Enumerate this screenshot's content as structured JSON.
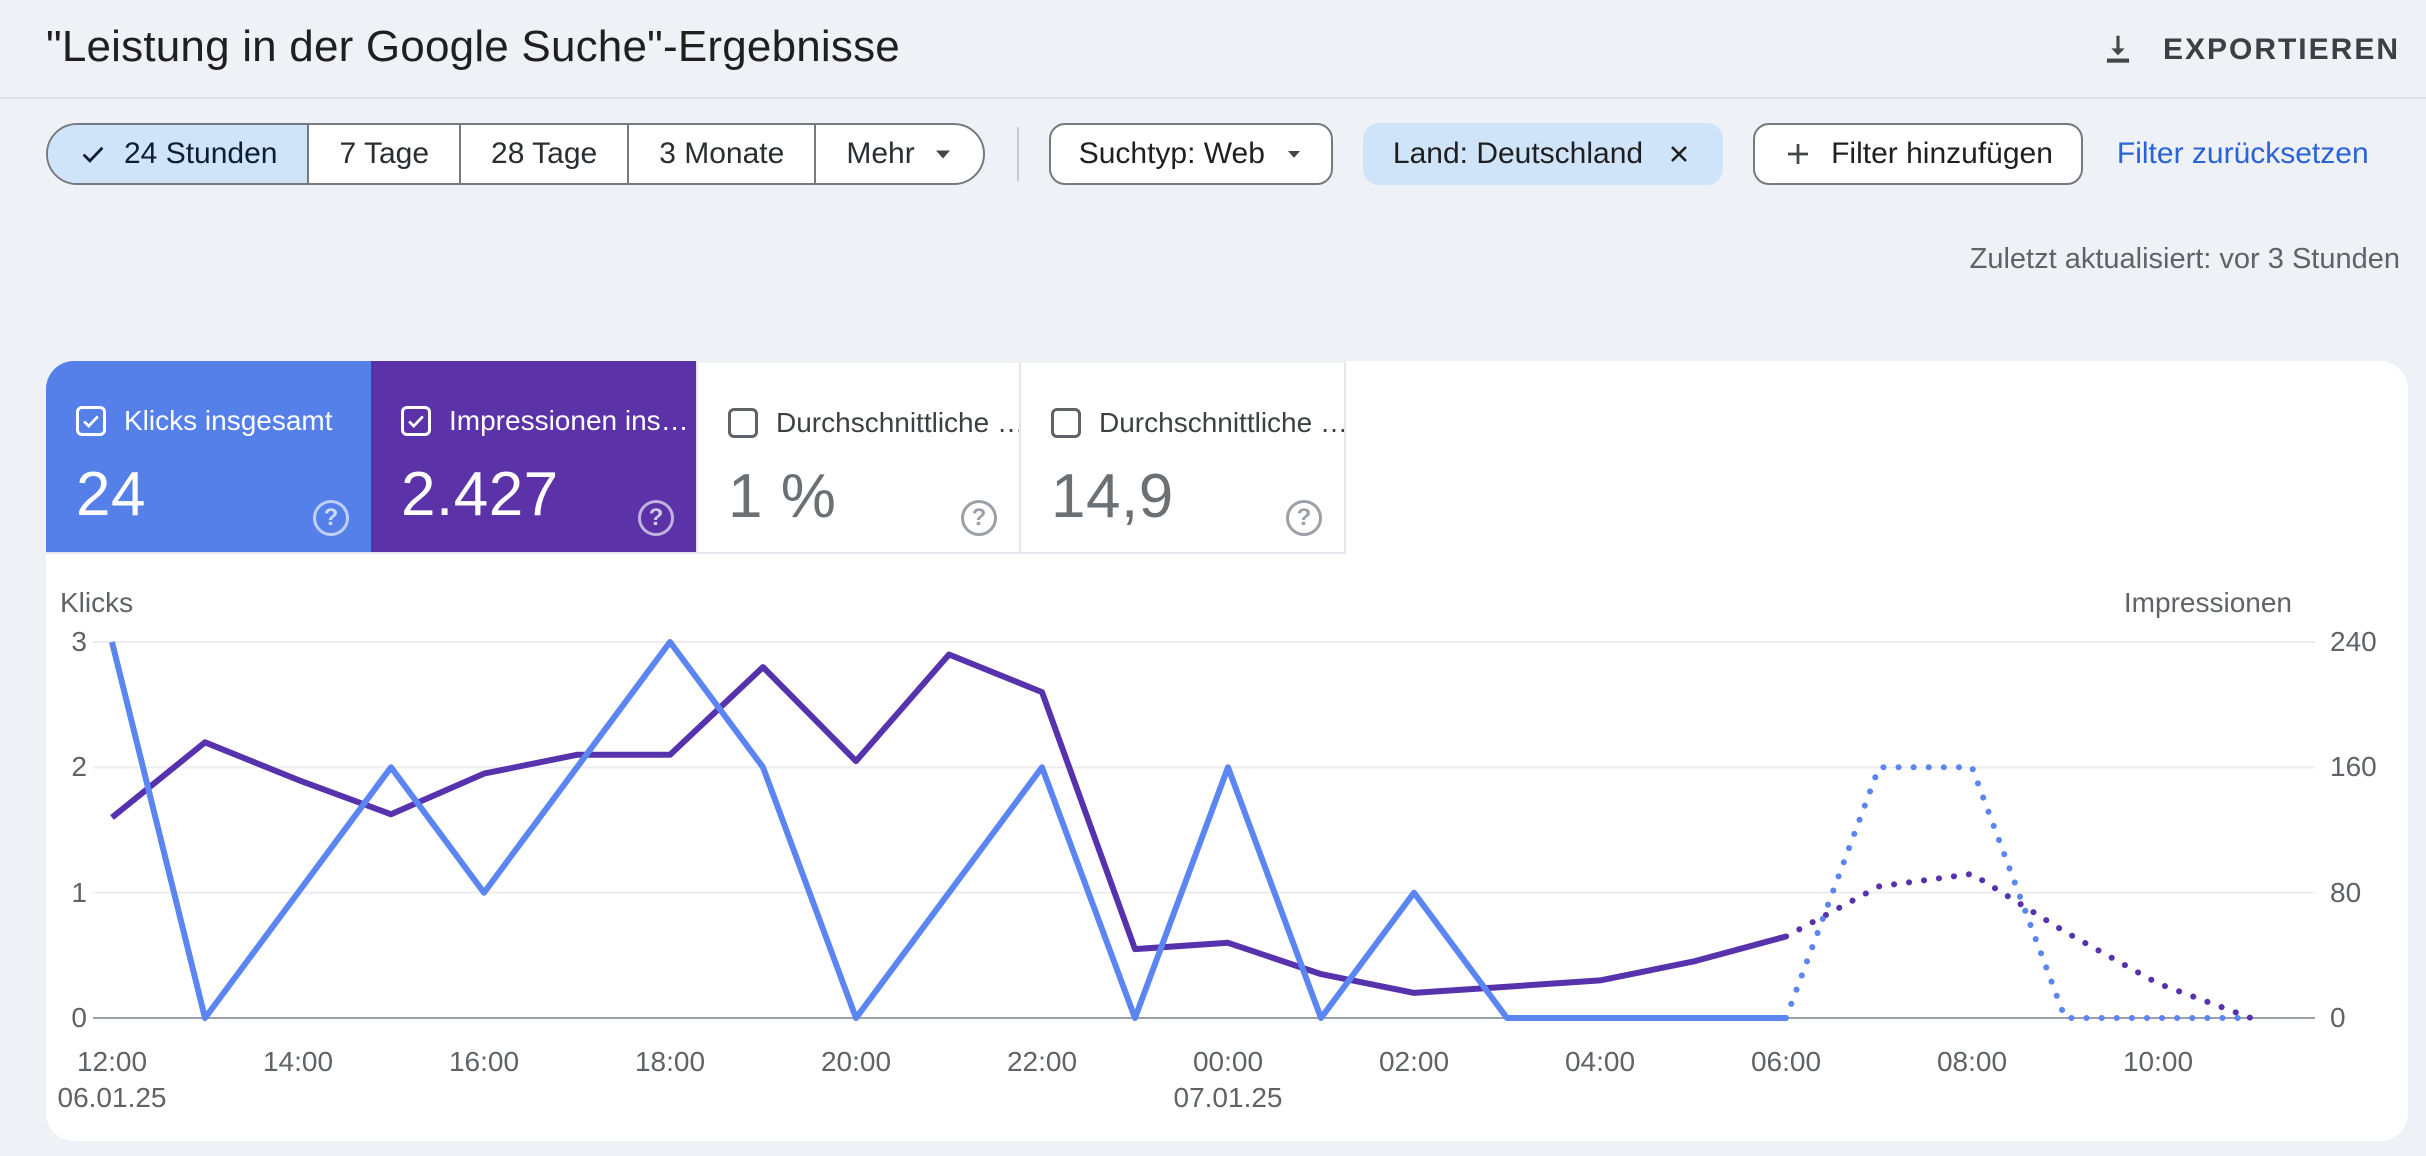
{
  "header": {
    "title": "\"Leistung in der Google Suche\"-Ergebnisse",
    "export_label": "EXPORTIEREN"
  },
  "toolbar": {
    "time_ranges": [
      {
        "label": "24 Stunden",
        "selected": true
      },
      {
        "label": "7 Tage",
        "selected": false
      },
      {
        "label": "28 Tage",
        "selected": false
      },
      {
        "label": "3 Monate",
        "selected": false
      },
      {
        "label": "Mehr",
        "selected": false
      }
    ],
    "search_type_filter": "Suchtyp: Web",
    "country_filter": "Land: Deutschland",
    "add_filter_label": "Filter hinzufügen",
    "reset_filters_label": "Filter zurücksetzen"
  },
  "status": {
    "last_updated": "Zuletzt aktualisiert: vor 3 Stunden"
  },
  "icons": {
    "help": "?"
  },
  "colors": {
    "clicks_blue": "#5580e9",
    "impressions_purple": "#5b32a8",
    "line_blue": "#5b86f2",
    "line_purple": "#5633ad",
    "selected_chip_bg": "#cfe3f9",
    "link_blue": "#2a62d9"
  },
  "metric_cards": [
    {
      "label": "Klicks insgesamt",
      "value": "24",
      "checked": true
    },
    {
      "label": "Impressionen ins…",
      "value": "2.427",
      "checked": true
    },
    {
      "label": "Durchschnittliche …",
      "value": "1 %",
      "checked": false
    },
    {
      "label": "Durchschnittliche …",
      "value": "14,9",
      "checked": false
    }
  ],
  "chart_data": {
    "type": "line",
    "x": [
      "12:00",
      "13:00",
      "14:00",
      "15:00",
      "16:00",
      "17:00",
      "18:00",
      "19:00",
      "20:00",
      "21:00",
      "22:00",
      "23:00",
      "00:00",
      "01:00",
      "02:00",
      "03:00",
      "04:00",
      "05:00",
      "06:00",
      "07:00",
      "08:00",
      "09:00",
      "10:00",
      "11:00"
    ],
    "series": [
      {
        "name": "Impressionen",
        "axis": "right",
        "color": "#5633ad",
        "values": [
          128,
          176,
          152,
          130,
          156,
          168,
          168,
          224,
          164,
          232,
          208,
          44,
          48,
          28,
          16,
          20,
          24,
          36,
          52,
          84,
          92,
          55,
          22,
          0
        ]
      },
      {
        "name": "Klicks",
        "axis": "left",
        "color": "#5b86f2",
        "values": [
          3,
          0,
          1,
          2,
          1,
          2,
          3,
          2,
          0,
          1,
          2,
          0,
          2,
          0,
          1,
          0,
          0,
          0,
          0,
          2,
          2,
          0,
          0,
          0
        ]
      }
    ],
    "dotted_from_index": 18,
    "left_axis": {
      "title": "Klicks",
      "max": 3,
      "ticks": [
        3,
        2,
        1,
        0
      ]
    },
    "right_axis": {
      "title": "Impressionen",
      "max": 240,
      "ticks": [
        240,
        160,
        80,
        0
      ]
    },
    "x_ticks": [
      {
        "index": 0,
        "time": "12:00",
        "date": "06.01.25"
      },
      {
        "index": 2,
        "time": "14:00",
        "date": ""
      },
      {
        "index": 4,
        "time": "16:00",
        "date": ""
      },
      {
        "index": 6,
        "time": "18:00",
        "date": ""
      },
      {
        "index": 8,
        "time": "20:00",
        "date": ""
      },
      {
        "index": 10,
        "time": "22:00",
        "date": ""
      },
      {
        "index": 12,
        "time": "00:00",
        "date": "07.01.25"
      },
      {
        "index": 14,
        "time": "02:00",
        "date": ""
      },
      {
        "index": 16,
        "time": "04:00",
        "date": ""
      },
      {
        "index": 18,
        "time": "06:00",
        "date": ""
      },
      {
        "index": 20,
        "time": "08:00",
        "date": ""
      },
      {
        "index": 22,
        "time": "10:00",
        "date": ""
      }
    ],
    "grid": true,
    "legend_position": "none"
  }
}
